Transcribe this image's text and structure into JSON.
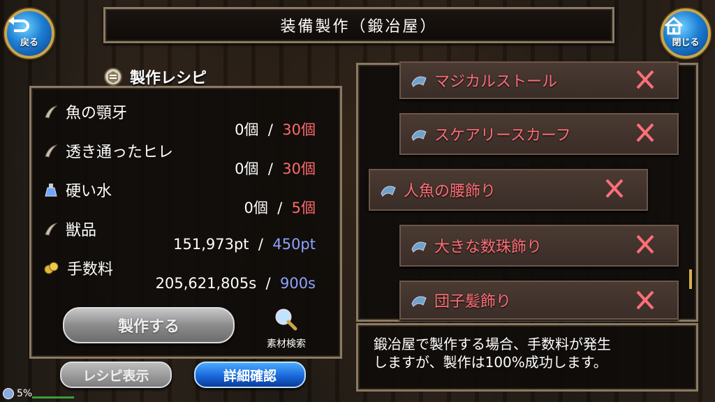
{
  "header": {
    "title": "装備製作（鍛冶屋）",
    "back_label": "戻る",
    "close_label": "閉じる"
  },
  "recipe": {
    "heading": "製作レシピ",
    "materials": [
      {
        "name": "魚の顎牙",
        "owned": "0個",
        "sep": "/",
        "required": "30個",
        "icon": "fang-icon",
        "req_color": "#ff6b6b"
      },
      {
        "name": "透き通ったヒレ",
        "owned": "0個",
        "sep": "/",
        "required": "30個",
        "icon": "fang-icon",
        "req_color": "#ff6b6b"
      },
      {
        "name": "硬い水",
        "owned": "0個",
        "sep": "/",
        "required": "5個",
        "icon": "potion-icon",
        "req_color": "#ff6b6b"
      },
      {
        "name": "獣品",
        "owned": "151,973pt",
        "sep": "/",
        "required": "450pt",
        "icon": "fang-icon",
        "req_color": "#8fa2ff"
      },
      {
        "name": "手数料",
        "owned": "205,621,805s",
        "sep": "/",
        "required": "900s",
        "icon": "coins-icon",
        "req_color": "#8fa2ff"
      }
    ],
    "craft_label": "製作する",
    "search_label": "素材検索",
    "recipe_view_label": "レシピ表示",
    "detail_label": "詳細確認"
  },
  "items": [
    {
      "name": "マジカルストール"
    },
    {
      "name": "スケアリースカーフ"
    },
    {
      "name": "人魚の腰飾り"
    },
    {
      "name": "大きな数珠飾り"
    },
    {
      "name": "団子髪飾り"
    }
  ],
  "description": "鍛冶屋で製作する場合、手数料が発生\nしますが、製作は100%成功します。",
  "status": {
    "percent": "5%"
  },
  "colors": {
    "unavailable": "#ff6f78",
    "frame": "#8b7a64",
    "accent_gold": "#c9a54b"
  }
}
